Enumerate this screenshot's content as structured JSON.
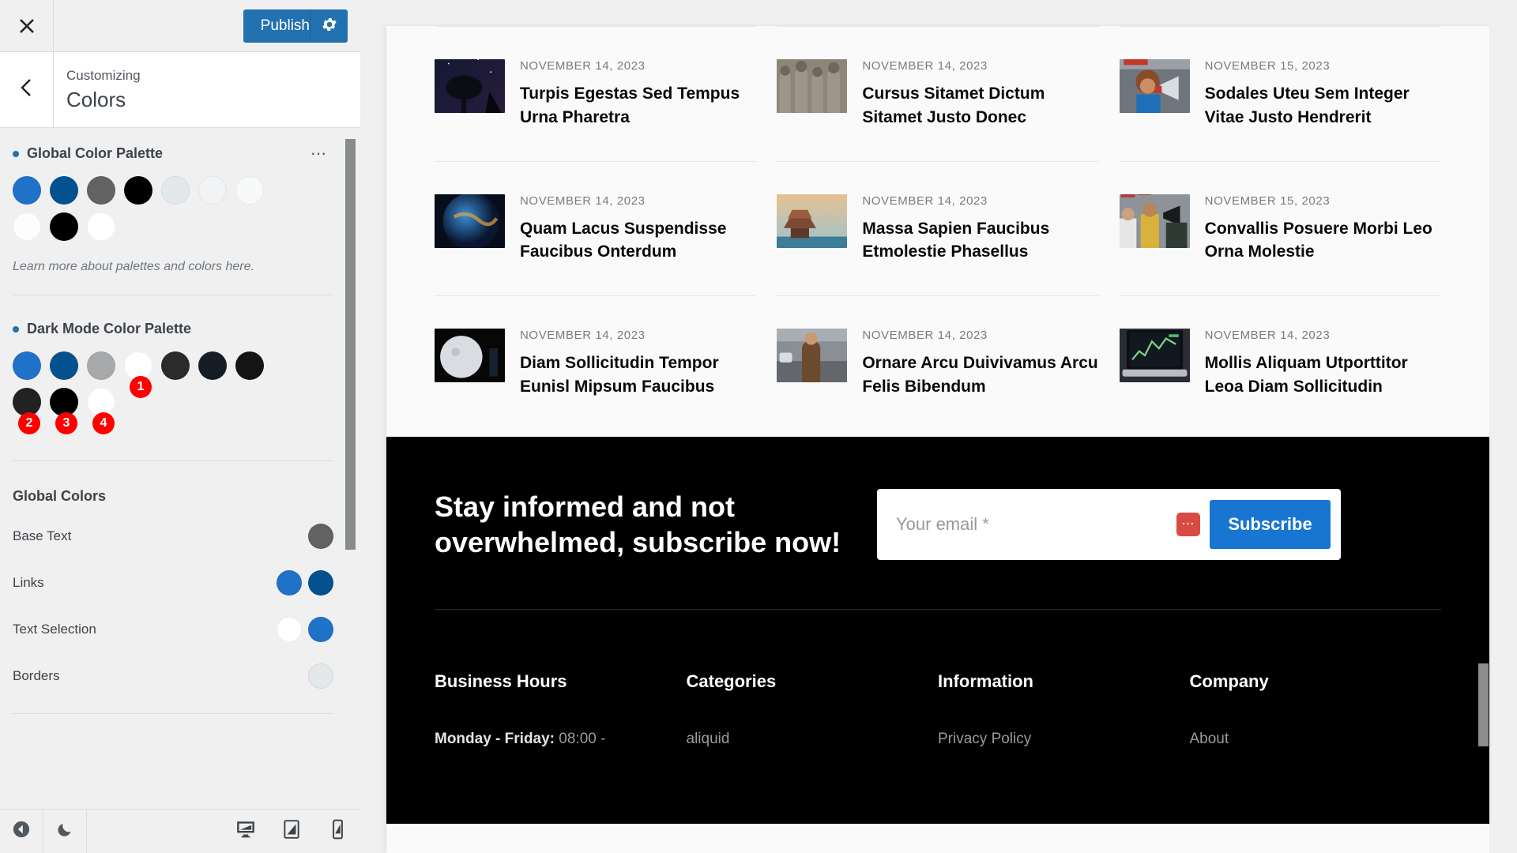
{
  "customizer": {
    "close_icon": "close-icon",
    "publish_label": "Publish",
    "gear_icon": "gear-icon",
    "back_icon": "chevron-left-icon",
    "breadcrumb": "Customizing",
    "section_heading": "Colors",
    "global_palette": {
      "title": "Global Color Palette",
      "kebab_icon": "more-options-icon",
      "swatches": [
        "#1f72c8",
        "#04518f",
        "#626262",
        "#000000",
        "#e3e8eb",
        "#f1f3f4",
        "#f8f9f9",
        "#fdfdfd",
        "#000000",
        "#ffffff"
      ],
      "helper_text": "Learn more about palettes and colors here."
    },
    "dark_palette": {
      "title": "Dark Mode Color Palette",
      "swatches": [
        "#1f72c8",
        "#04518f",
        "#a7a9ab",
        "#ffffff",
        "#2b2b2b",
        "#161d26",
        "#141414",
        "#222222",
        "#000000",
        "#ffffff"
      ],
      "badges": [
        {
          "label": "1",
          "index": 3
        },
        {
          "label": "2",
          "index": 7
        },
        {
          "label": "3",
          "index": 8
        },
        {
          "label": "4",
          "index": 9
        }
      ],
      "badge_color": "#ff0000"
    },
    "global_colors": {
      "title": "Global Colors",
      "rows": [
        {
          "label": "Base Text",
          "colors": [
            "#626262"
          ]
        },
        {
          "label": "Links",
          "colors": [
            "#1f72c8",
            "#04518f"
          ]
        },
        {
          "label": "Text Selection",
          "colors": [
            "#ffffff",
            "#1f72c8"
          ]
        },
        {
          "label": "Borders",
          "colors": [
            "#e3e8eb"
          ]
        }
      ]
    },
    "footer": {
      "collapse_icon": "collapse-sidebar-icon",
      "dark_mode_icon": "moon-icon",
      "devices": [
        {
          "name": "desktop-preview",
          "icon": "desktop-icon"
        },
        {
          "name": "tablet-preview",
          "icon": "tablet-icon"
        },
        {
          "name": "mobile-preview",
          "icon": "mobile-icon"
        }
      ]
    },
    "accent_color": "#2271b1"
  },
  "preview": {
    "articles": [
      [
        {
          "date": "NOVEMBER 14, 2023",
          "title": "Turpis Egestas Sed Tempus Urna Pharetra",
          "thumb": "radio-telescope-night-sky"
        },
        {
          "date": "NOVEMBER 14, 2023",
          "title": "Quam Lacus Suspendisse Faucibus Onterdum",
          "thumb": "earth-from-space"
        },
        {
          "date": "NOVEMBER 14, 2023",
          "title": "Diam Sollicitudin Tempor Eunisl Mipsum Faucibus",
          "thumb": "moon-dark-room"
        }
      ],
      [
        {
          "date": "NOVEMBER 14, 2023",
          "title": "Cursus Sitamet Dictum Sitamet Justo Donec",
          "thumb": "terracotta-army-statues"
        },
        {
          "date": "NOVEMBER 14, 2023",
          "title": "Massa Sapien Faucibus Etmolestie Phasellus",
          "thumb": "asian-temple-seaside"
        },
        {
          "date": "NOVEMBER 14, 2023",
          "title": "Ornare Arcu Duivivamus Arcu Felis Bibendum",
          "thumb": "woman-city-street"
        }
      ],
      [
        {
          "date": "NOVEMBER 15, 2023",
          "title": "Sodales Uteu Sem Integer Vitae Justo Hendrerit",
          "thumb": "protest-megaphone"
        },
        {
          "date": "NOVEMBER 15, 2023",
          "title": "Convallis Posuere Morbi Leo Orna Molestie",
          "thumb": "protest-crowd-flags"
        },
        {
          "date": "NOVEMBER 14, 2023",
          "title": "Mollis Aliquam Utporttitor Leoa Diam Sollicitudin",
          "thumb": "laptop-trading-chart"
        }
      ]
    ],
    "subscribe": {
      "heading": "Stay informed and not overwhelmed, subscribe now!",
      "email_placeholder": "Your email *",
      "email_value": "",
      "password_manager_icon": "lastpass-icon",
      "button_label": "Subscribe",
      "button_color": "#1875d1"
    },
    "footer_columns": [
      {
        "title": "Business Hours",
        "items": [
          "Monday - Friday:|08:00 -"
        ]
      },
      {
        "title": "Categories",
        "items": [
          "aliquid"
        ]
      },
      {
        "title": "Information",
        "items": [
          "Privacy Policy"
        ]
      },
      {
        "title": "Company",
        "items": [
          "About"
        ]
      }
    ]
  }
}
